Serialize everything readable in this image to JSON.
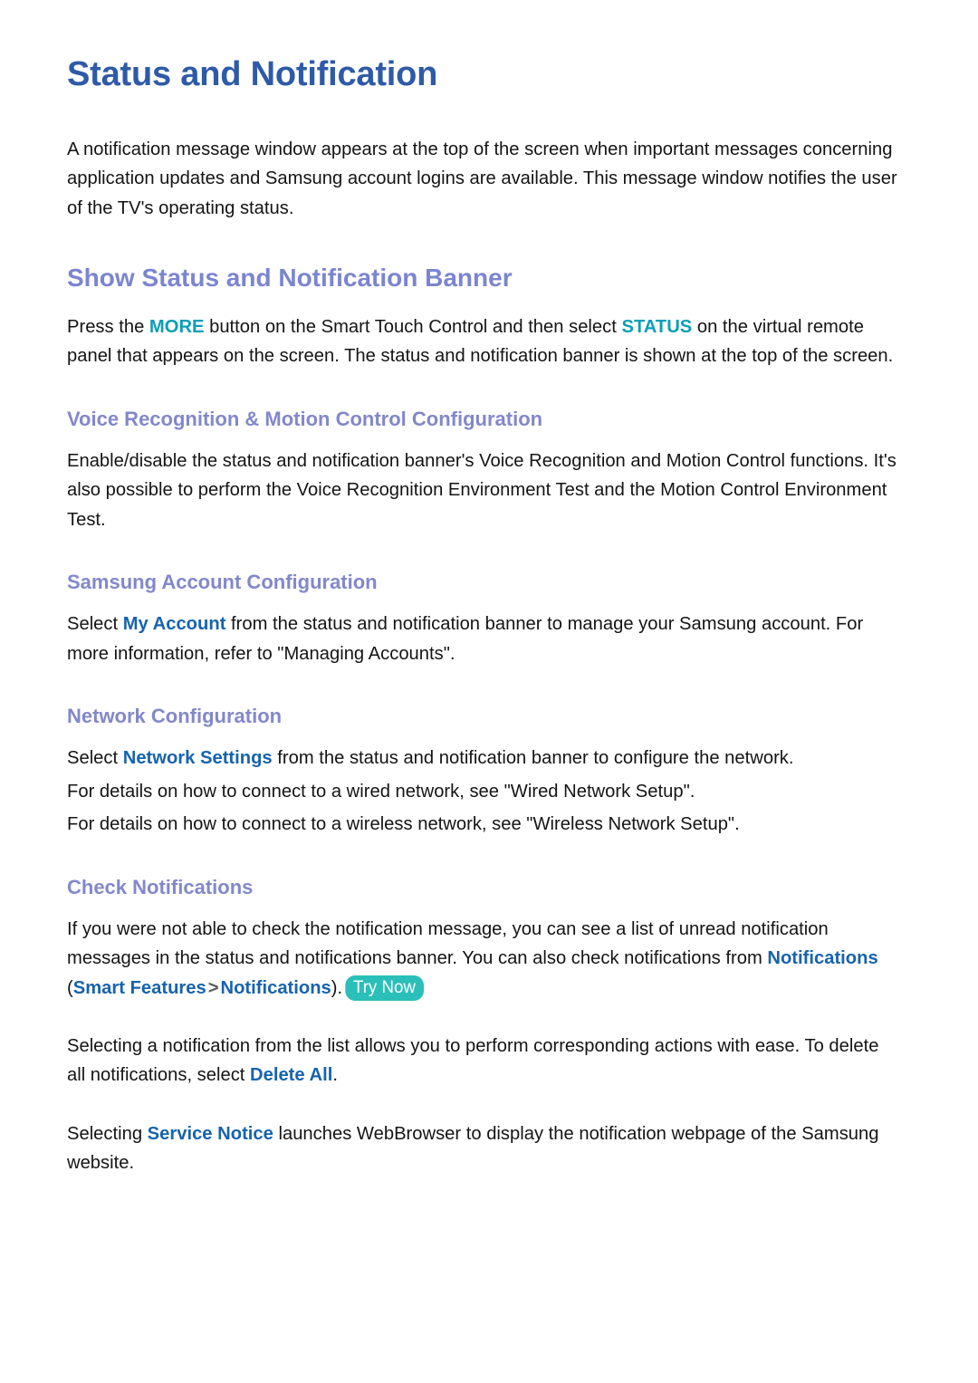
{
  "document": {
    "title": "Status and Notification",
    "intro_paragraph": "A notification message window appears at the top of the screen when important messages concerning application updates and Samsung account logins are available. This message window notifies the user of the TV's operating status."
  },
  "sections": [
    {
      "heading": "Show Status and Notification Banner",
      "paragraph_part_1": "Press the ",
      "term_more": "MORE",
      "paragraph_part_2": " button on the Smart Touch Control and then select ",
      "term_status": "STATUS",
      "paragraph_part_3": " on the virtual remote panel that appears on the screen. The status and notification banner is shown at the top of the screen."
    }
  ],
  "subsections": [
    {
      "heading": "Voice Recognition & Motion Control Configuration",
      "paragraph": "Enable/disable the status and notification banner's Voice Recognition and Motion Control functions. It's also possible to perform the Voice Recognition Environment Test and the Motion Control Environment Test."
    },
    {
      "heading": "Samsung Account Configuration",
      "paragraph_part_1": "Select ",
      "term_my_account": "My Account",
      "paragraph_part_2": " from the status and notification banner to manage your Samsung account. For more information, refer to \"Managing Accounts\"."
    },
    {
      "heading": "Network Configuration",
      "line1_part_1": "Select ",
      "term_network_settings": "Network Settings",
      "line1_part_2": " from the status and notification banner to configure the network.",
      "line2": "For details on how to connect to a wired network, see \"Wired Network Setup\".",
      "line3": "For details on how to connect to a wireless network, see \"Wireless Network Setup\"."
    },
    {
      "heading": "Check Notifications",
      "para1_part_1": "If you were not able to check the notification message, you can see a list of unread notification messages in the status and notifications banner. You can also check notifications from ",
      "term_notifications_inline": "Notifications",
      "para1_open_paren": " (",
      "term_smart_features": "Smart Features",
      "path_separator": ">",
      "term_notifications_path": "Notifications",
      "para1_close_paren": ").",
      "try_now_badge": "Try Now",
      "para2_part_1": "Selecting a notification from the list allows you to perform corresponding actions with ease. To delete all notifications, select ",
      "term_delete_all": "Delete All",
      "para2_part_2": ".",
      "para3_part_1": "Selecting ",
      "term_service_notice": "Service Notice",
      "para3_part_2": " launches WebBrowser to display the notification webpage of the Samsung website."
    }
  ],
  "colors": {
    "doc_title": "#2e5aa8",
    "section_heading": "#7b85cf",
    "sub_heading": "#8288c9",
    "term_teal": "#0b9fb5",
    "term_blue": "#1763ad",
    "badge_background": "#2abfb8",
    "body_text": "#141414"
  }
}
